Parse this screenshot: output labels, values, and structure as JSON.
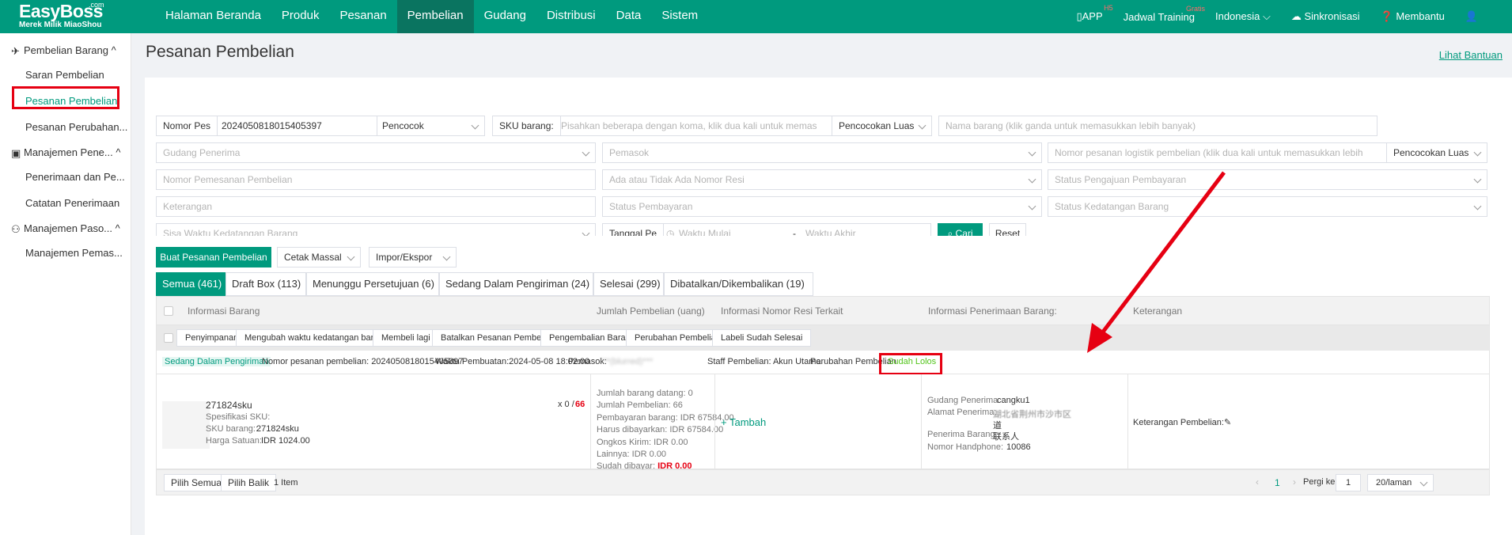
{
  "logo": {
    "name": "EasyBoss",
    "suffix": ".com",
    "tagline": "Merek Milik MiaoShou"
  },
  "nav": [
    "Halaman Beranda",
    "Produk",
    "Pesanan",
    "Pembelian",
    "Gudang",
    "Distribusi",
    "Data",
    "Sistem"
  ],
  "nav_active": "Pembelian",
  "topright": {
    "app": "APP",
    "app_badge": "H5",
    "training": "Jadwal Training",
    "training_badge": "Gratis",
    "language": "Indonesia",
    "sync": "Sinkronisasi",
    "help": "Membantu"
  },
  "sidebar": {
    "group1": "Pembelian Barang",
    "g1_items": [
      "Saran Pembelian",
      "Pesanan Pembelian",
      "Pesanan Perubahan..."
    ],
    "group2": "Manajemen Pene...",
    "g2_items": [
      "Penerimaan dan Pe...",
      "Catatan Penerimaan"
    ],
    "group3": "Manajemen Paso...",
    "g3_items": [
      "Manajemen Pemas..."
    ]
  },
  "page": {
    "title": "Pesanan Pembelian",
    "help_link": "Lihat Bantuan"
  },
  "filters": {
    "order_no_label": "Nomor Pes",
    "order_no_value": "2024050818015405397",
    "order_no_match": "Pencocok",
    "sku_label": "SKU barang:",
    "sku_placeholder": "Pisahkan beberapa dengan koma, klik dua kali untuk memas",
    "sku_match": "Pencocokan Luas",
    "item_name": "Nama barang (klik ganda untuk memasukkan lebih banyak)",
    "warehouse": "Gudang Penerima",
    "supplier": "Pemasok",
    "logistics_no": "Nomor pesanan logistik pembelian (klik dua kali untuk memasukkan lebih",
    "logistics_match": "Pencocokan Luas",
    "purchase_order_no": "Nomor Pemesanan Pembelian",
    "has_tracking": "Ada atau Tidak Ada Nomor Resi",
    "payment_request_status": "Status Pengajuan Pembayaran",
    "remarks": "Keterangan",
    "payment_status": "Status Pembayaran",
    "arrival_status": "Status Kedatangan Barang",
    "remaining_time": "Sisa Waktu Kedatangan Barang",
    "date_label": "Tanggal Pe",
    "start": "Waktu Mulai",
    "end": "Waktu Akhir",
    "sep": "-",
    "search": "Cari",
    "reset": "Reset"
  },
  "toolbar": {
    "create": "Buat Pesanan Pembelian",
    "print": "Cetak Massal",
    "import": "Impor/Ekspor"
  },
  "tabs": [
    "Semua (461)",
    "Draft Box (113)",
    "Menunggu Persetujuan (6)",
    "Sedang Dalam Pengiriman (24)",
    "Selesai (299)",
    "Dibatalkan/Dikembalikan (19)"
  ],
  "table_headers": [
    "Informasi Barang",
    "Jumlah Pembelian (uang)",
    "Informasi Nomor Resi Terkait",
    "Informasi Penerimaan Barang:",
    "Keterangan"
  ],
  "actions": [
    "Penyimpanan",
    "Mengubah waktu kedatangan barang",
    "Membeli lagi",
    "Batalkan Pesanan Pembelian",
    "Pengembalian Barang",
    "Perubahan Pembelian",
    "Labeli Sudah Selesai"
  ],
  "order": {
    "status": "Sedang Dalam Pengiriman",
    "order_no": "Nomor pesanan pembelian: 2024050818015405397",
    "created": "Waktu Pembuatan:2024-05-08 18:02:00",
    "supplier": "Pemasok:",
    "supplier_val": "***(blurred)***",
    "staff": "Staff Pembelian: Akun Utama",
    "change": "Perubahan Pembelian",
    "change_status": "Sudah Lolos",
    "sku_name": "271824sku",
    "spec": "Spesifikasi SKU:",
    "sku_label": "SKU barang::",
    "sku_val": "271824sku",
    "price_label": "Harga Satuan:",
    "price_val": "IDR 1024.00",
    "qty_prefix": "x 0 /",
    "qty_total": "66",
    "amounts": [
      "Jumlah barang datang: 0",
      "Jumlah Pembelian: 66",
      "Pembayaran barang: IDR 67584.00",
      "Harus dibayarkan: IDR 67584.00",
      "Ongkos Kirim: IDR 0.00",
      "Lainnya: IDR 0.00"
    ],
    "paid_label": "Sudah dibayar:",
    "paid_val": "IDR 0.00",
    "add": "Tambah",
    "wh_label": "Gudang Penerima:",
    "wh_val": "cangku1",
    "addr_label": "Alamat Penerima:",
    "addr_val1": "湖北省荆州市沙市区",
    "addr_val2": "道",
    "receiver_label": "Penerima Barang:",
    "receiver_val": "联系人",
    "phone_label": "Nomor Handphone:",
    "phone_val": "10086",
    "remark": "Keterangan Pembelian:"
  },
  "footer": {
    "select_all": "Pilih Semua",
    "invert": "Pilih Balik",
    "count": "1 Item",
    "page": "1",
    "goto": "Pergi ke",
    "goto_val": "1",
    "per_page": "20/laman"
  }
}
